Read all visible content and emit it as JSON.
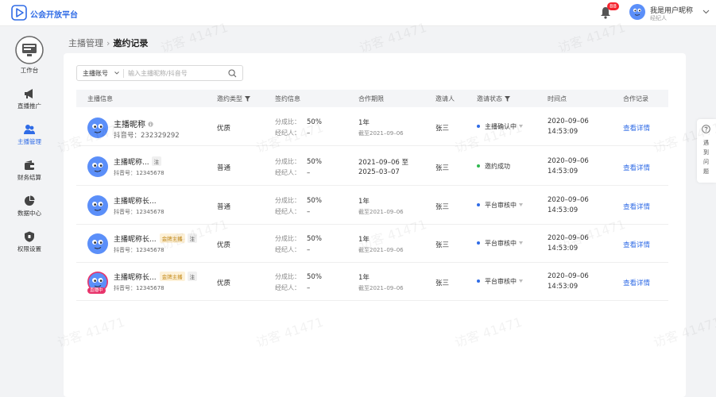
{
  "app": {
    "brand": "公会开放平台"
  },
  "header": {
    "notification_count": "88",
    "user_name": "我是用户昵称",
    "user_role": "经纪人"
  },
  "sidebar": {
    "items": [
      {
        "label": "工作台",
        "icon": "monitor-icon"
      },
      {
        "label": "直播推广",
        "icon": "megaphone-icon"
      },
      {
        "label": "主播管理",
        "icon": "users-icon",
        "active": true
      },
      {
        "label": "财务结算",
        "icon": "wallet-icon"
      },
      {
        "label": "数据中心",
        "icon": "pie-chart-icon"
      },
      {
        "label": "权限设置",
        "icon": "shield-icon"
      }
    ]
  },
  "breadcrumb": {
    "parent": "主播管理",
    "separator": "›",
    "current": "邀约记录"
  },
  "search": {
    "select_value": "主播账号",
    "placeholder": "输入主播昵称/抖音号"
  },
  "table": {
    "headers": {
      "anchor": "主播信息",
      "invite_type": "邀约类型",
      "contract": "签约信息",
      "period": "合作期限",
      "inviter": "邀请人",
      "status": "邀请状态",
      "time": "时间点",
      "record": "合作记录"
    },
    "rows": [
      {
        "nick": "主播昵称",
        "douyin_label": "抖音号：",
        "douyin_id": "232329292",
        "invite_type": "优质",
        "share_label": "分成比：",
        "share_value": "50%",
        "agent_label": "经纪人：",
        "agent_value": "–",
        "period_main": "1年",
        "period_sub": "截至2021–09–06",
        "inviter": "张三",
        "status": "主播确认中",
        "status_color": "#2f6be6",
        "date": "2020–09–06",
        "time": "14:53:09",
        "link": "查看详情"
      },
      {
        "nick": "主播昵称...",
        "note": "注",
        "douyin_label": "抖音号：",
        "douyin_id": "12345678",
        "invite_type": "普通",
        "share_label": "分成比：",
        "share_value": "50%",
        "agent_label": "经纪人：",
        "agent_value": "–",
        "period_main": "2021–09–06 至",
        "period_main2": "2025–03–07",
        "inviter": "张三",
        "status": "邀约成功",
        "status_color": "#2fb84f",
        "date": "2020–09–06",
        "time": "14:53:09",
        "link": "查看详情"
      },
      {
        "nick": "主播昵称长...",
        "douyin_label": "抖音号：",
        "douyin_id": "12345678",
        "invite_type": "普通",
        "share_label": "分成比：",
        "share_value": "50%",
        "agent_label": "经纪人：",
        "agent_value": "–",
        "period_main": "1年",
        "period_sub": "截至2021–09–06",
        "inviter": "张三",
        "status": "平台审核中",
        "status_color": "#2f6be6",
        "date": "2020–09–06",
        "time": "14:53:09",
        "link": "查看详情"
      },
      {
        "nick": "主播昵称长...",
        "gold": "金牌主播",
        "note": "注",
        "douyin_label": "抖音号：",
        "douyin_id": "12345678",
        "invite_type": "优质",
        "share_label": "分成比：",
        "share_value": "50%",
        "agent_label": "经纪人：",
        "agent_value": "–",
        "period_main": "1年",
        "period_sub": "截至2021–09–06",
        "inviter": "张三",
        "status": "平台审核中",
        "status_color": "#2f6be6",
        "date": "2020–09–06",
        "time": "14:53:09",
        "link": "查看详情"
      },
      {
        "nick": "主播昵称长...",
        "gold": "金牌主播",
        "note": "注",
        "live": "直播中",
        "douyin_label": "抖音号：",
        "douyin_id": "12345678",
        "invite_type": "优质",
        "share_label": "分成比：",
        "share_value": "50%",
        "agent_label": "经纪人：",
        "agent_value": "–",
        "period_main": "1年",
        "period_sub": "截至2021–09–06",
        "inviter": "张三",
        "status": "平台审核中",
        "status_color": "#2f6be6",
        "date": "2020–09–06",
        "time": "14:53:09",
        "link": "查看详情"
      }
    ]
  },
  "help": {
    "label": "遇到问题"
  },
  "watermark": "访客 41471"
}
